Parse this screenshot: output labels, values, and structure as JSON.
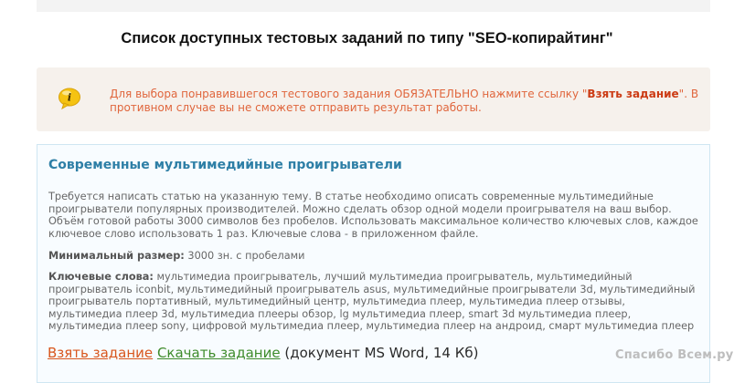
{
  "page_title": "Список доступных тестовых заданий по типу \"SEO-копирайтинг\"",
  "notice": {
    "icon": "info-bubble-icon",
    "before": "Для выбора понравившегося тестового задания ОБЯЗАТЕЛЬНО нажмите ссылку \"",
    "link_name": "Взять задание",
    "after": "\". В противном случае вы не сможете отправить результат работы."
  },
  "task": {
    "title": "Современные мультимедийные проигрыватели",
    "description": "Требуется написать статью на указанную тему. В статье необходимо описать современные мультимедийные проигрыватели популярных производителей. Можно сделать обзор одной модели проигрывателя на ваш выбор. Объём готовой работы 3000 символов без пробелов. Использовать максимальное количество ключевых слов, каждое ключевое слово использовать 1 раз. Ключевые слова - в приложенном файле.",
    "min_size_label": "Минимальный размер:",
    "min_size_value": "3000 зн. с пробелами",
    "keywords_label": "Ключевые слова:",
    "keywords_value": "мультимедиа проигрыватель, лучший мультимедиа проигрыватель, мультимедийный проигрыватель iconbit, мультимедийный проигрыватель asus, мультимедийные проигрыватели 3d, мультимедийный проигрыватель портативный, мультимедийный центр, мультимедиа плеер, мультимедиа плеер отзывы, мультимедиа плеер 3d, мультимедиа плееры обзор, lg мультимедиа плеер, smart 3d мультимедиа плеер, мультимедиа плеер sony, цифровой мультимедиа плеер, мультимедиа плеер на андроид, смарт мультимедиа плеер",
    "take_link": "Взять задание",
    "download_link": "Скачать задание",
    "file_info": "(документ MS Word, 14 Кб)"
  },
  "watermark": "Спасибо Всем.ру",
  "colors": {
    "notice_bg": "#f6f1ec",
    "notice_text": "#e0663d",
    "card_bg": "#f8fcff",
    "card_border": "#cfe6f2",
    "task_title": "#2e7fa6",
    "take_link": "#d8561d",
    "download_link": "#3f8c2c"
  }
}
